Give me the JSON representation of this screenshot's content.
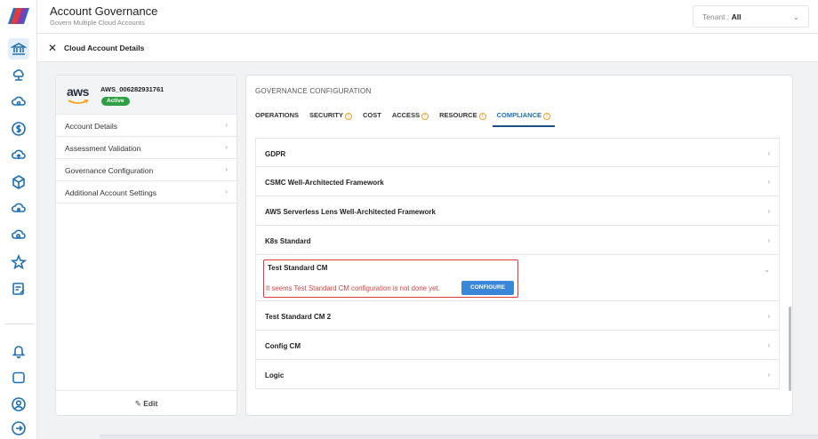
{
  "app": {
    "title": "Account Governance",
    "subtitle": "Govern Multiple Cloud Accounts"
  },
  "tenant": {
    "label": "Tenant :",
    "value": "All"
  },
  "subheader": {
    "title": "Cloud Account Details"
  },
  "account": {
    "provider": "aws",
    "id": "AWS_006282931761",
    "status": "Active"
  },
  "left_menu": [
    {
      "label": "Account Details"
    },
    {
      "label": "Assessment Validation"
    },
    {
      "label": "Governance Configuration"
    },
    {
      "label": "Additional Account Settings"
    }
  ],
  "edit_label": "Edit",
  "governance": {
    "title": "GOVERNANCE CONFIGURATION",
    "tabs": [
      {
        "label": "OPERATIONS"
      },
      {
        "label": "SECURITY"
      },
      {
        "label": "COST"
      },
      {
        "label": "ACCESS"
      },
      {
        "label": "RESOURCE"
      },
      {
        "label": "COMPLIANCE"
      }
    ],
    "rows": [
      {
        "label": "GDPR"
      },
      {
        "label": "CSMC Well-Architected Framework"
      },
      {
        "label": "AWS Serverless Lens Well-Architected Framework"
      },
      {
        "label": "K8s Standard"
      },
      {
        "label": "Test Standard CM",
        "message": "It seems Test Standard CM configuration is not done yet.",
        "button": "CONFIGURE"
      },
      {
        "label": "Test Standard CM 2"
      },
      {
        "label": "Config CM"
      },
      {
        "label": "Logic"
      }
    ]
  },
  "colors": {
    "accent": "#1f6fb2",
    "badge": "#2ea043",
    "alert": "#e23a3a",
    "button": "#3a86d9"
  }
}
